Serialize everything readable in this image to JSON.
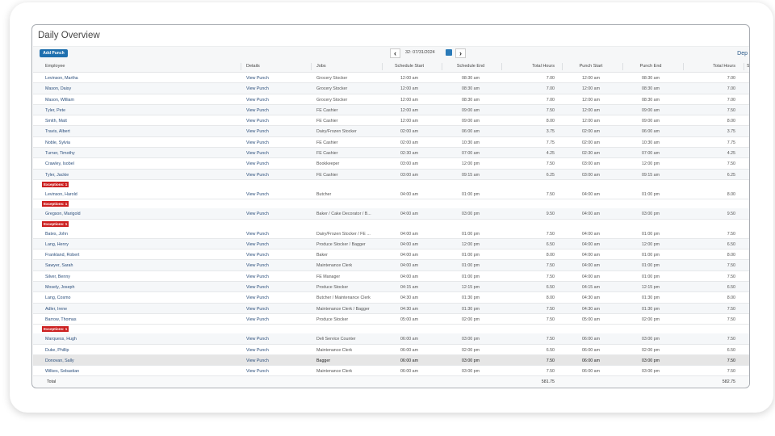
{
  "title": "Daily Overview",
  "toolbar": {
    "add_punch": "Add Punch",
    "date": "32: 07/31/2024",
    "prev_icon": "chevron-left-icon",
    "next_icon": "chevron-right-icon",
    "calendar_icon": "calendar-icon",
    "dep_link": "Dep"
  },
  "columns": [
    "Employee",
    "Details",
    "Jobs",
    "Schedule Start",
    "Schedule End",
    "Total Hours",
    "Punch Start",
    "Punch End",
    "Total Hours",
    "S"
  ],
  "exception_label": "Exceptions: 1",
  "rows": [
    {
      "employee": "Levinson, Martha",
      "details": "View Punch",
      "job": "Grocery Stocker",
      "sched_start": "12:00 am",
      "sched_end": "08:30 am",
      "sched_hours": "7.00",
      "punch_start": "12:00 am",
      "punch_end": "08:30 am",
      "punch_hours": "7.00"
    },
    {
      "employee": "Mason, Daisy",
      "details": "View Punch",
      "job": "Grocery Stocker",
      "sched_start": "12:00 am",
      "sched_end": "08:30 am",
      "sched_hours": "7.00",
      "punch_start": "12:00 am",
      "punch_end": "08:30 am",
      "punch_hours": "7.00"
    },
    {
      "employee": "Mason, William",
      "details": "View Punch",
      "job": "Grocery Stocker",
      "sched_start": "12:00 am",
      "sched_end": "08:30 am",
      "sched_hours": "7.00",
      "punch_start": "12:00 am",
      "punch_end": "08:30 am",
      "punch_hours": "7.00"
    },
    {
      "employee": "Tyler, Pete",
      "details": "View Punch",
      "job": "FE Cashier",
      "sched_start": "12:00 am",
      "sched_end": "09:00 am",
      "sched_hours": "7.50",
      "punch_start": "12:00 am",
      "punch_end": "09:00 am",
      "punch_hours": "7.50"
    },
    {
      "employee": "Smith, Matt",
      "details": "View Punch",
      "job": "FE Cashier",
      "sched_start": "12:00 am",
      "sched_end": "09:00 am",
      "sched_hours": "8.00",
      "punch_start": "12:00 am",
      "punch_end": "09:00 am",
      "punch_hours": "8.00"
    },
    {
      "employee": "Travis, Albert",
      "details": "View Punch",
      "job": "Dairy/Frozen Stocker",
      "sched_start": "02:00 am",
      "sched_end": "06:00 am",
      "sched_hours": "3.75",
      "punch_start": "02:00 am",
      "punch_end": "06:00 am",
      "punch_hours": "3.75"
    },
    {
      "employee": "Noble, Sylvia",
      "details": "View Punch",
      "job": "FE Cashier",
      "sched_start": "02:00 am",
      "sched_end": "10:30 am",
      "sched_hours": "7.75",
      "punch_start": "02:00 am",
      "punch_end": "10:30 am",
      "punch_hours": "7.75"
    },
    {
      "employee": "Turner, Timothy",
      "details": "View Punch",
      "job": "FE Cashier",
      "sched_start": "02:30 am",
      "sched_end": "07:00 am",
      "sched_hours": "4.25",
      "punch_start": "02:30 am",
      "punch_end": "07:00 am",
      "punch_hours": "4.25"
    },
    {
      "employee": "Crawley, Isobel",
      "details": "View Punch",
      "job": "Bookkeeper",
      "sched_start": "03:00 am",
      "sched_end": "12:00 pm",
      "sched_hours": "7.50",
      "punch_start": "03:00 am",
      "punch_end": "12:00 pm",
      "punch_hours": "7.50"
    },
    {
      "employee": "Tyler, Jackie",
      "details": "View Punch",
      "job": "FE Cashier",
      "sched_start": "03:00 am",
      "sched_end": "09:15 am",
      "sched_hours": "6.25",
      "punch_start": "03:00 am",
      "punch_end": "09:15 am",
      "punch_hours": "6.25"
    },
    {
      "exception": true,
      "employee": "Levinson, Harold",
      "details": "View Punch",
      "job": "Butcher",
      "sched_start": "04:00 am",
      "sched_end": "01:00 pm",
      "sched_hours": "7.50",
      "punch_start": "04:00 am",
      "punch_end": "01:00 pm",
      "punch_hours": "8.00"
    },
    {
      "exception": true,
      "employee": "Gregson, Marigold",
      "details": "View Punch",
      "job": "Baker / Cake Decorator / B...",
      "sched_start": "04:00 am",
      "sched_end": "03:00 pm",
      "sched_hours": "9.50",
      "punch_start": "04:00 am",
      "punch_end": "03:00 pm",
      "punch_hours": "9.50"
    },
    {
      "exception": true,
      "employee": "Bates, John",
      "details": "View Punch",
      "job": "Dairy/Frozen Stocker / FE ...",
      "sched_start": "04:00 am",
      "sched_end": "01:00 pm",
      "sched_hours": "7.50",
      "punch_start": "04:00 am",
      "punch_end": "01:00 pm",
      "punch_hours": "7.50"
    },
    {
      "employee": "Lang, Henry",
      "details": "View Punch",
      "job": "Produce Stocker / Bagger",
      "sched_start": "04:00 am",
      "sched_end": "12:00 pm",
      "sched_hours": "6.50",
      "punch_start": "04:00 am",
      "punch_end": "12:00 pm",
      "punch_hours": "6.50"
    },
    {
      "employee": "Frankland, Robert",
      "details": "View Punch",
      "job": "Baker",
      "sched_start": "04:00 am",
      "sched_end": "01:00 pm",
      "sched_hours": "8.00",
      "punch_start": "04:00 am",
      "punch_end": "01:00 pm",
      "punch_hours": "8.00"
    },
    {
      "employee": "Sawyer, Sarah",
      "details": "View Punch",
      "job": "Maintenance Clerk",
      "sched_start": "04:00 am",
      "sched_end": "01:00 pm",
      "sched_hours": "7.50",
      "punch_start": "04:00 am",
      "punch_end": "01:00 pm",
      "punch_hours": "7.50"
    },
    {
      "employee": "Silver, Benny",
      "details": "View Punch",
      "job": "FE Manager",
      "sched_start": "04:00 am",
      "sched_end": "01:00 pm",
      "sched_hours": "7.50",
      "punch_start": "04:00 am",
      "punch_end": "01:00 pm",
      "punch_hours": "7.50"
    },
    {
      "employee": "Mosely, Joseph",
      "details": "View Punch",
      "job": "Produce Stocker",
      "sched_start": "04:15 am",
      "sched_end": "12:15 pm",
      "sched_hours": "6.50",
      "punch_start": "04:15 am",
      "punch_end": "12:15 pm",
      "punch_hours": "6.50"
    },
    {
      "employee": "Lang, Cosmo",
      "details": "View Punch",
      "job": "Butcher / Maintenance Clerk",
      "sched_start": "04:30 am",
      "sched_end": "01:30 pm",
      "sched_hours": "8.00",
      "punch_start": "04:30 am",
      "punch_end": "01:30 pm",
      "punch_hours": "8.00"
    },
    {
      "employee": "Adler, Irene",
      "details": "View Punch",
      "job": "Maintenance Clerk / Bagger",
      "sched_start": "04:30 am",
      "sched_end": "01:30 pm",
      "sched_hours": "7.50",
      "punch_start": "04:30 am",
      "punch_end": "01:30 pm",
      "punch_hours": "7.50"
    },
    {
      "employee": "Barrow, Thomas",
      "details": "View Punch",
      "job": "Produce Stocker",
      "sched_start": "05:00 am",
      "sched_end": "02:00 pm",
      "sched_hours": "7.50",
      "punch_start": "05:00 am",
      "punch_end": "02:00 pm",
      "punch_hours": "7.50"
    },
    {
      "exception": true,
      "employee": "Marquess, Hugh",
      "details": "View Punch",
      "job": "Deli Service Counter",
      "sched_start": "06:00 am",
      "sched_end": "03:00 pm",
      "sched_hours": "7.50",
      "punch_start": "06:00 am",
      "punch_end": "03:00 pm",
      "punch_hours": "7.50"
    },
    {
      "employee": "Duke, Phillip",
      "details": "View Punch",
      "job": "Maintenance Clerk",
      "sched_start": "06:00 am",
      "sched_end": "02:00 pm",
      "sched_hours": "6.50",
      "punch_start": "06:00 am",
      "punch_end": "02:00 pm",
      "punch_hours": "6.50"
    },
    {
      "selected": true,
      "employee": "Donovan, Sally",
      "details": "View Punch",
      "job": "Bagger",
      "sched_start": "06:00 am",
      "sched_end": "03:00 pm",
      "sched_hours": "7.50",
      "punch_start": "06:00 am",
      "punch_end": "03:00 pm",
      "punch_hours": "7.50"
    },
    {
      "employee": "Wilkes, Sebastian",
      "details": "View Punch",
      "job": "Maintenance Clerk",
      "sched_start": "06:00 am",
      "sched_end": "03:00 pm",
      "sched_hours": "7.50",
      "punch_start": "06:00 am",
      "punch_end": "03:00 pm",
      "punch_hours": "7.50"
    }
  ],
  "total": {
    "label": "Total",
    "sched_hours": "581.75",
    "punch_hours": "582.75"
  },
  "colors": {
    "accent": "#1e6fae",
    "exception": "#cc1f1f",
    "link": "#2c4f7c"
  }
}
